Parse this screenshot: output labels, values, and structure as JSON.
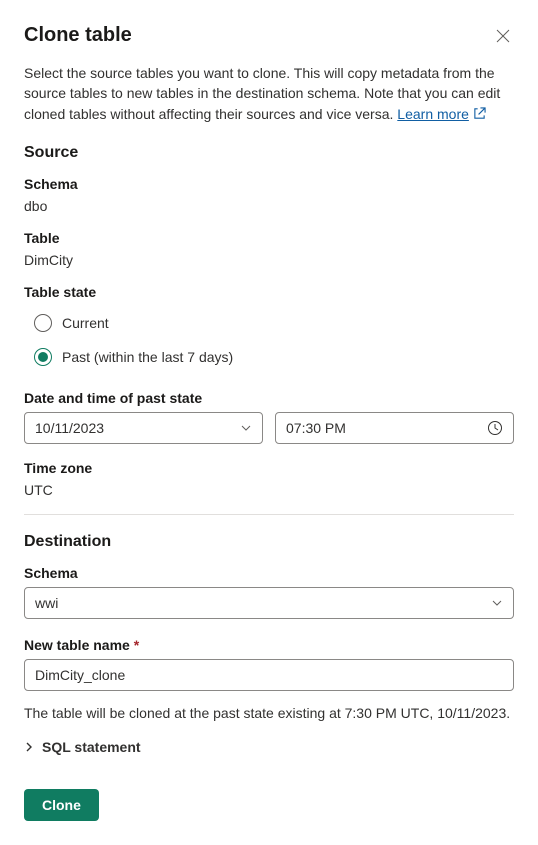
{
  "header": {
    "title": "Clone table"
  },
  "description": {
    "text": "Select the source tables you want to clone. This will copy metadata from the source tables to new tables in the destination schema. Note that you can edit cloned tables without affecting their sources and vice versa. ",
    "learn_more": "Learn more "
  },
  "source": {
    "heading": "Source",
    "schema_label": "Schema",
    "schema_value": "dbo",
    "table_label": "Table",
    "table_value": "DimCity",
    "state_label": "Table state",
    "radio_current": "Current",
    "radio_past": "Past (within the last 7 days)",
    "datetime_label": "Date and time of past state",
    "date_value": "10/11/2023",
    "time_value": "07:30 PM",
    "tz_label": "Time zone",
    "tz_value": "UTC"
  },
  "destination": {
    "heading": "Destination",
    "schema_label": "Schema",
    "schema_value": "wwi",
    "name_label": "New table name",
    "name_value": "DimCity_clone"
  },
  "summary": "The table will be cloned at the past state existing at 7:30 PM UTC, 10/11/2023.",
  "expander": {
    "label": "SQL statement"
  },
  "actions": {
    "clone": "Clone"
  }
}
